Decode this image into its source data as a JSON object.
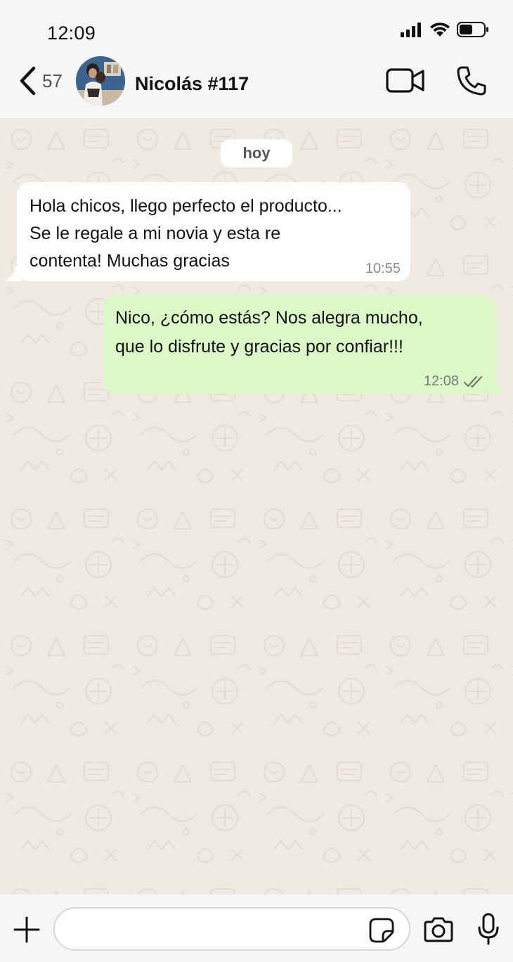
{
  "status_bar": {
    "time": "12:09"
  },
  "header": {
    "back_count": "57",
    "contact_name": "Nicolás #117"
  },
  "chat": {
    "date_label": "hoy",
    "messages": [
      {
        "direction": "incoming",
        "lines": [
          "Hola chicos, llego perfecto el producto...",
          "Se le regale a mi novia y esta re",
          "contenta! Muchas gracias"
        ],
        "time": "10:55"
      },
      {
        "direction": "outgoing",
        "lines": [
          "Nico, ¿cómo estás? Nos alegra mucho,",
          "que lo disfrute y gracias por confiar!!!"
        ],
        "time": "12:08",
        "status": "read"
      }
    ]
  },
  "input_bar": {
    "placeholder": ""
  },
  "colors": {
    "chat_background": "#efeae2",
    "outgoing_bubble": "#dcf8c6",
    "incoming_bubble": "#ffffff",
    "bar_background": "#f6f6f6"
  }
}
